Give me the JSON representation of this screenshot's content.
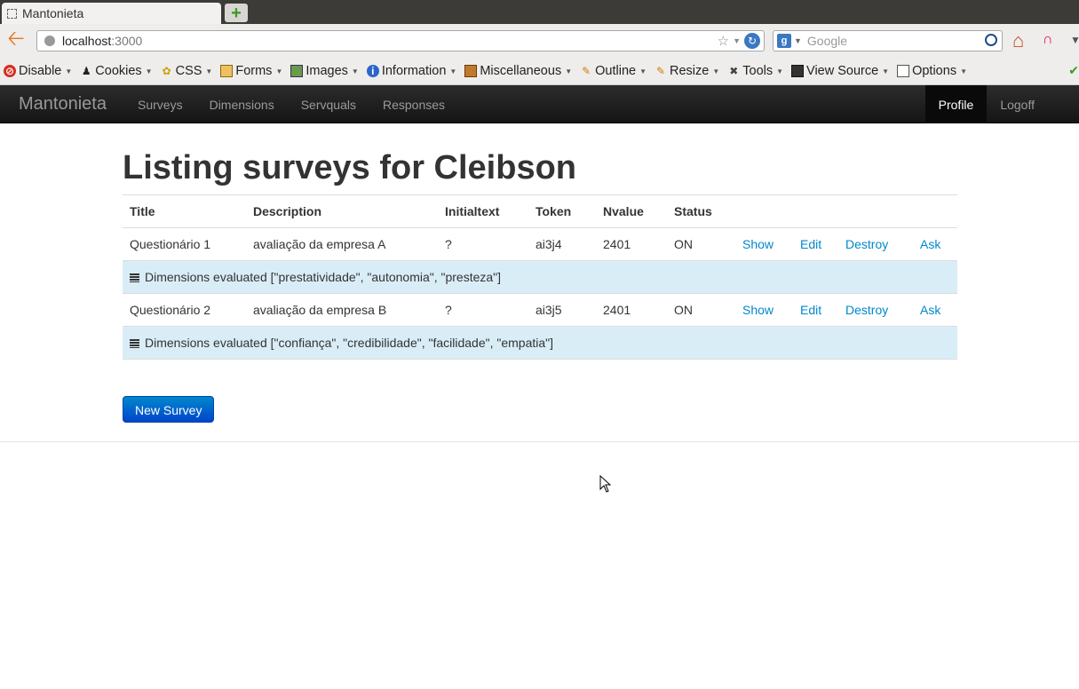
{
  "browser": {
    "tab_title": "Mantonieta",
    "new_tab_label": "+",
    "url_host": "localhost",
    "url_port": ":3000",
    "search_placeholder": "Google",
    "search_engine_label": "g"
  },
  "devtoolbar": {
    "items": [
      {
        "label": "Disable",
        "icon": "disable-icon"
      },
      {
        "label": "Cookies",
        "icon": "cookies-icon"
      },
      {
        "label": "CSS",
        "icon": "css-icon"
      },
      {
        "label": "Forms",
        "icon": "forms-icon"
      },
      {
        "label": "Images",
        "icon": "images-icon"
      },
      {
        "label": "Information",
        "icon": "information-icon"
      },
      {
        "label": "Miscellaneous",
        "icon": "miscellaneous-icon"
      },
      {
        "label": "Outline",
        "icon": "outline-icon"
      },
      {
        "label": "Resize",
        "icon": "resize-icon"
      },
      {
        "label": "Tools",
        "icon": "tools-icon"
      },
      {
        "label": "View Source",
        "icon": "view-source-icon"
      },
      {
        "label": "Options",
        "icon": "options-icon"
      }
    ]
  },
  "app": {
    "brand": "Mantonieta",
    "nav": [
      "Surveys",
      "Dimensions",
      "Servquals",
      "Responses"
    ],
    "nav_right": {
      "profile": "Profile",
      "logoff": "Logoff"
    }
  },
  "page": {
    "title": "Listing surveys for Cleibson",
    "columns": [
      "Title",
      "Description",
      "Initialtext",
      "Token",
      "Nvalue",
      "Status"
    ],
    "rows": [
      {
        "title": "Questionário 1",
        "description": "avaliação da empresa A",
        "initialtext": "?",
        "token": "ai3j4",
        "nvalue": "2401",
        "status": "ON",
        "actions": {
          "show": "Show",
          "edit": "Edit",
          "destroy": "Destroy",
          "ask": "Ask"
        },
        "dimensions": "Dimensions evaluated [\"prestatividade\", \"autonomia\", \"presteza\"]"
      },
      {
        "title": "Questionário 2",
        "description": "avaliação da empresa B",
        "initialtext": "?",
        "token": "ai3j5",
        "nvalue": "2401",
        "status": "ON",
        "actions": {
          "show": "Show",
          "edit": "Edit",
          "destroy": "Destroy",
          "ask": "Ask"
        },
        "dimensions": "Dimensions evaluated [\"confiança\", \"credibilidade\", \"facilidade\", \"empatia\"]"
      }
    ],
    "new_button": "New Survey"
  },
  "colors": {
    "link": "#0088cc",
    "navbar_bg": "#1b1b1b",
    "info_row": "#d9edf7",
    "primary_button": "#0066cc"
  }
}
